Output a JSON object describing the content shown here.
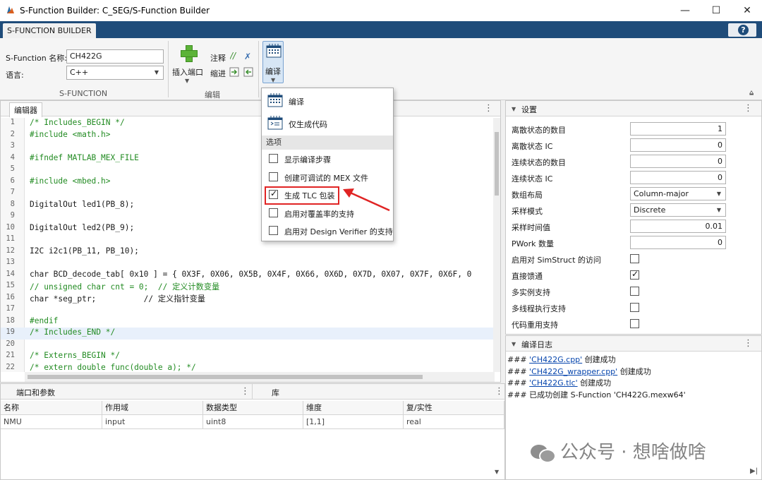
{
  "window": {
    "title": "S-Function Builder: C_SEG/S-Function Builder",
    "minimize": "—",
    "maximize": "☐",
    "close": "✕"
  },
  "ribbon_tab": {
    "label": "S-FUNCTION BUILDER",
    "help": "?"
  },
  "ribbon": {
    "sfun_name_label": "S-Function 名称:",
    "sfun_name_value": "CH422G",
    "language_label": "语言:",
    "language_value": "C++",
    "section_sfunction": "S-FUNCTION",
    "insert_port": "插入端口",
    "comment": "注释",
    "indent": "缩进",
    "section_edit": "编辑",
    "build": "编译"
  },
  "popup": {
    "build": "编译",
    "generate_code_only": "仅生成代码",
    "options_header": "选项",
    "options": [
      {
        "label": "显示编译步骤",
        "checked": false
      },
      {
        "label": "创建可调试的 MEX 文件",
        "checked": false
      },
      {
        "label": "生成 TLC 包装",
        "checked": true
      },
      {
        "label": "启用对覆盖率的支持",
        "checked": false
      },
      {
        "label": "启用对 Design Verifier 的支持",
        "checked": false
      }
    ]
  },
  "editor": {
    "tab": "编辑器",
    "lines": [
      {
        "n": "1",
        "t": "/* Includes_BEGIN */",
        "c": "cmt"
      },
      {
        "n": "2",
        "t": "#include <math.h>",
        "c": "cmt"
      },
      {
        "n": "3",
        "t": "",
        "c": ""
      },
      {
        "n": "4",
        "t": "#ifndef MATLAB_MEX_FILE",
        "c": "cmt"
      },
      {
        "n": "5",
        "t": "",
        "c": ""
      },
      {
        "n": "6",
        "t": "#include <mbed.h>",
        "c": "cmt"
      },
      {
        "n": "7",
        "t": "",
        "c": ""
      },
      {
        "n": "8",
        "t": "DigitalOut led1(PB_8);",
        "c": ""
      },
      {
        "n": "9",
        "t": "",
        "c": ""
      },
      {
        "n": "10",
        "t": "DigitalOut led2(PB_9);",
        "c": ""
      },
      {
        "n": "11",
        "t": "",
        "c": ""
      },
      {
        "n": "12",
        "t": "I2C i2c1(PB_11, PB_10);",
        "c": ""
      },
      {
        "n": "13",
        "t": "",
        "c": ""
      },
      {
        "n": "14",
        "t": "char BCD_decode_tab[ 0x10 ] = { 0X3F, 0X06, 0X5B, 0X4F, 0X66, 0X6D, 0X7D, 0X07, 0X7F, 0X6F, 0",
        "c": "kwline"
      },
      {
        "n": "15",
        "t": "// unsigned char cnt = 0;  // 定义计数变量",
        "c": "cmt"
      },
      {
        "n": "16",
        "t": "char *seg_ptr;          // 定义指针变量",
        "c": "kwline2"
      },
      {
        "n": "17",
        "t": "",
        "c": ""
      },
      {
        "n": "18",
        "t": "#endif",
        "c": "cmt"
      },
      {
        "n": "19",
        "t": "/* Includes_END */",
        "c": "cmt hl"
      },
      {
        "n": "20",
        "t": "",
        "c": ""
      },
      {
        "n": "21",
        "t": "/* Externs_BEGIN */",
        "c": "cmt"
      },
      {
        "n": "22",
        "t": "/* extern double func(double a); */",
        "c": "cmt"
      }
    ]
  },
  "ports": {
    "title": "端口和参数",
    "library_tab": "库",
    "columns": [
      "名称",
      "作用域",
      "数据类型",
      "维度",
      "复/实性"
    ],
    "rows": [
      [
        "NMU",
        "input",
        "uint8",
        "[1,1]",
        "real"
      ]
    ]
  },
  "settings": {
    "title": "设置",
    "rows": [
      {
        "label": "离散状态的数目",
        "type": "input",
        "value": "1"
      },
      {
        "label": "离散状态 IC",
        "type": "input",
        "value": "0"
      },
      {
        "label": "连续状态的数目",
        "type": "input",
        "value": "0"
      },
      {
        "label": "连续状态 IC",
        "type": "input",
        "value": "0"
      },
      {
        "label": "数组布局",
        "type": "select",
        "value": "Column-major"
      },
      {
        "label": "采样模式",
        "type": "select",
        "value": "Discrete"
      },
      {
        "label": "采样时间值",
        "type": "input",
        "value": "0.01"
      },
      {
        "label": "PWork 数量",
        "type": "input",
        "value": "0"
      },
      {
        "label": "启用对 SimStruct 的访问",
        "type": "check",
        "checked": false
      },
      {
        "label": "直接馈通",
        "type": "check",
        "checked": true
      },
      {
        "label": "多实例支持",
        "type": "check",
        "checked": false
      },
      {
        "label": "多线程执行支持",
        "type": "check",
        "checked": false
      },
      {
        "label": "代码重用支持",
        "type": "check",
        "checked": false
      }
    ]
  },
  "log": {
    "title": "编译日志",
    "lines": [
      {
        "prefix": "### ",
        "link": "'CH422G.cpp'",
        "suffix": " 创建成功"
      },
      {
        "prefix": "### ",
        "link": "'CH422G_wrapper.cpp'",
        "suffix": " 创建成功"
      },
      {
        "prefix": "### ",
        "link": "'CH422G.tlc'",
        "suffix": " 创建成功"
      },
      {
        "prefix": "### 已成功创建 S-Function 'CH422G.mexw64'",
        "link": "",
        "suffix": ""
      }
    ]
  },
  "watermark": {
    "text": "公众号 · 想啥做啥"
  },
  "colors": {
    "accent": "#1f4c7a",
    "highlight_box": "#e02424",
    "comment": "#228b22",
    "link": "#0645ad"
  }
}
